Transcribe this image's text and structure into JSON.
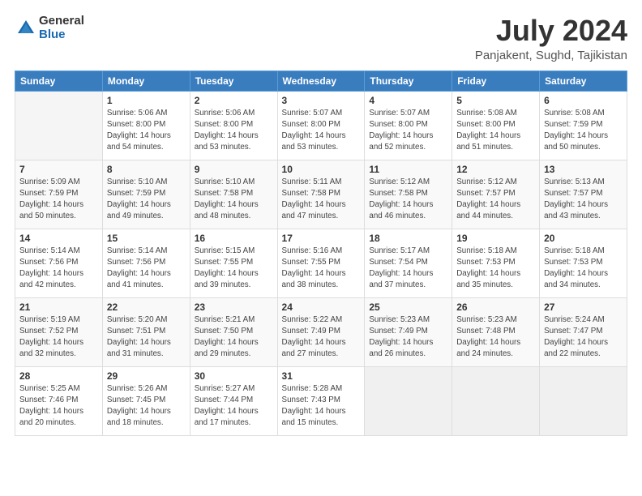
{
  "logo": {
    "general": "General",
    "blue": "Blue"
  },
  "title": "July 2024",
  "subtitle": "Panjakent, Sughd, Tajikistan",
  "header_days": [
    "Sunday",
    "Monday",
    "Tuesday",
    "Wednesday",
    "Thursday",
    "Friday",
    "Saturday"
  ],
  "weeks": [
    [
      {
        "day": "",
        "info": ""
      },
      {
        "day": "1",
        "info": "Sunrise: 5:06 AM\nSunset: 8:00 PM\nDaylight: 14 hours\nand 54 minutes."
      },
      {
        "day": "2",
        "info": "Sunrise: 5:06 AM\nSunset: 8:00 PM\nDaylight: 14 hours\nand 53 minutes."
      },
      {
        "day": "3",
        "info": "Sunrise: 5:07 AM\nSunset: 8:00 PM\nDaylight: 14 hours\nand 53 minutes."
      },
      {
        "day": "4",
        "info": "Sunrise: 5:07 AM\nSunset: 8:00 PM\nDaylight: 14 hours\nand 52 minutes."
      },
      {
        "day": "5",
        "info": "Sunrise: 5:08 AM\nSunset: 8:00 PM\nDaylight: 14 hours\nand 51 minutes."
      },
      {
        "day": "6",
        "info": "Sunrise: 5:08 AM\nSunset: 7:59 PM\nDaylight: 14 hours\nand 50 minutes."
      }
    ],
    [
      {
        "day": "7",
        "info": "Sunrise: 5:09 AM\nSunset: 7:59 PM\nDaylight: 14 hours\nand 50 minutes."
      },
      {
        "day": "8",
        "info": "Sunrise: 5:10 AM\nSunset: 7:59 PM\nDaylight: 14 hours\nand 49 minutes."
      },
      {
        "day": "9",
        "info": "Sunrise: 5:10 AM\nSunset: 7:58 PM\nDaylight: 14 hours\nand 48 minutes."
      },
      {
        "day": "10",
        "info": "Sunrise: 5:11 AM\nSunset: 7:58 PM\nDaylight: 14 hours\nand 47 minutes."
      },
      {
        "day": "11",
        "info": "Sunrise: 5:12 AM\nSunset: 7:58 PM\nDaylight: 14 hours\nand 46 minutes."
      },
      {
        "day": "12",
        "info": "Sunrise: 5:12 AM\nSunset: 7:57 PM\nDaylight: 14 hours\nand 44 minutes."
      },
      {
        "day": "13",
        "info": "Sunrise: 5:13 AM\nSunset: 7:57 PM\nDaylight: 14 hours\nand 43 minutes."
      }
    ],
    [
      {
        "day": "14",
        "info": "Sunrise: 5:14 AM\nSunset: 7:56 PM\nDaylight: 14 hours\nand 42 minutes."
      },
      {
        "day": "15",
        "info": "Sunrise: 5:14 AM\nSunset: 7:56 PM\nDaylight: 14 hours\nand 41 minutes."
      },
      {
        "day": "16",
        "info": "Sunrise: 5:15 AM\nSunset: 7:55 PM\nDaylight: 14 hours\nand 39 minutes."
      },
      {
        "day": "17",
        "info": "Sunrise: 5:16 AM\nSunset: 7:55 PM\nDaylight: 14 hours\nand 38 minutes."
      },
      {
        "day": "18",
        "info": "Sunrise: 5:17 AM\nSunset: 7:54 PM\nDaylight: 14 hours\nand 37 minutes."
      },
      {
        "day": "19",
        "info": "Sunrise: 5:18 AM\nSunset: 7:53 PM\nDaylight: 14 hours\nand 35 minutes."
      },
      {
        "day": "20",
        "info": "Sunrise: 5:18 AM\nSunset: 7:53 PM\nDaylight: 14 hours\nand 34 minutes."
      }
    ],
    [
      {
        "day": "21",
        "info": "Sunrise: 5:19 AM\nSunset: 7:52 PM\nDaylight: 14 hours\nand 32 minutes."
      },
      {
        "day": "22",
        "info": "Sunrise: 5:20 AM\nSunset: 7:51 PM\nDaylight: 14 hours\nand 31 minutes."
      },
      {
        "day": "23",
        "info": "Sunrise: 5:21 AM\nSunset: 7:50 PM\nDaylight: 14 hours\nand 29 minutes."
      },
      {
        "day": "24",
        "info": "Sunrise: 5:22 AM\nSunset: 7:49 PM\nDaylight: 14 hours\nand 27 minutes."
      },
      {
        "day": "25",
        "info": "Sunrise: 5:23 AM\nSunset: 7:49 PM\nDaylight: 14 hours\nand 26 minutes."
      },
      {
        "day": "26",
        "info": "Sunrise: 5:23 AM\nSunset: 7:48 PM\nDaylight: 14 hours\nand 24 minutes."
      },
      {
        "day": "27",
        "info": "Sunrise: 5:24 AM\nSunset: 7:47 PM\nDaylight: 14 hours\nand 22 minutes."
      }
    ],
    [
      {
        "day": "28",
        "info": "Sunrise: 5:25 AM\nSunset: 7:46 PM\nDaylight: 14 hours\nand 20 minutes."
      },
      {
        "day": "29",
        "info": "Sunrise: 5:26 AM\nSunset: 7:45 PM\nDaylight: 14 hours\nand 18 minutes."
      },
      {
        "day": "30",
        "info": "Sunrise: 5:27 AM\nSunset: 7:44 PM\nDaylight: 14 hours\nand 17 minutes."
      },
      {
        "day": "31",
        "info": "Sunrise: 5:28 AM\nSunset: 7:43 PM\nDaylight: 14 hours\nand 15 minutes."
      },
      {
        "day": "",
        "info": ""
      },
      {
        "day": "",
        "info": ""
      },
      {
        "day": "",
        "info": ""
      }
    ]
  ]
}
